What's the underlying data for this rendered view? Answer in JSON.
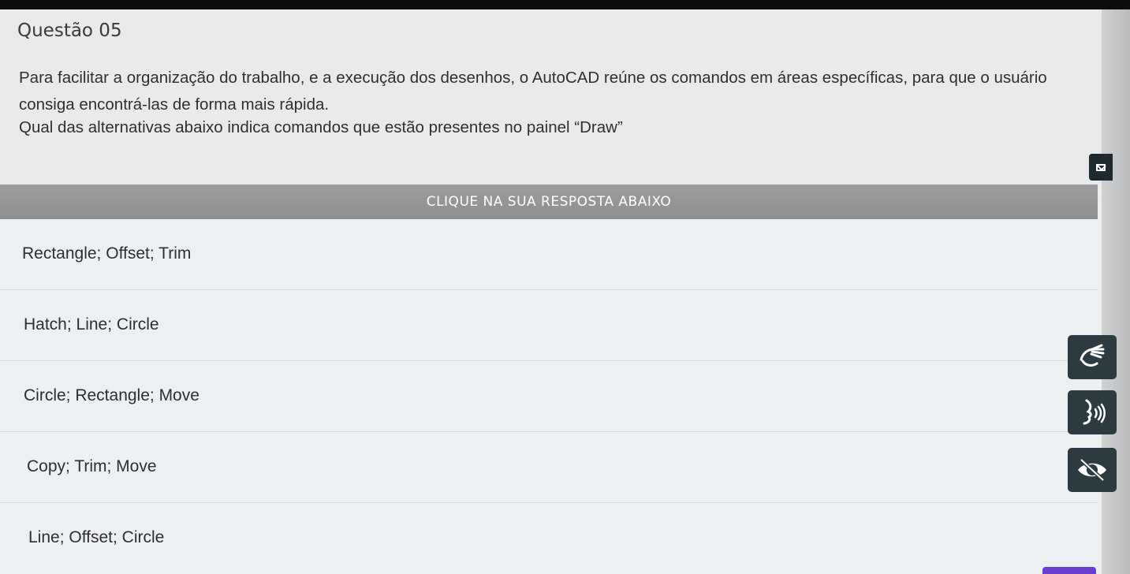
{
  "question": {
    "title": "Questão 05",
    "text": "Para facilitar a organização do trabalho, e a execução dos desenhos, o AutoCAD reúne os comandos em áreas específicas, para que o usuário consiga encontrá-las de forma mais rápida.",
    "prompt": "Qual das alternativas abaixo indica comandos que estão presentes no painel “Draw”"
  },
  "instruction": "CLIQUE NA SUA RESPOSTA ABAIXO",
  "answers": [
    {
      "label": "Rectangle; Offset; Trim"
    },
    {
      "label": "Hatch; Line; Circle"
    },
    {
      "label": "Circle; Rectangle; Move"
    },
    {
      "label": "Copy; Trim; Move"
    },
    {
      "label": "Line; Offset; Circle"
    }
  ],
  "accessibility": {
    "icons": [
      "mail-icon",
      "sign-language-icon",
      "audio-speaker-icon",
      "hide-eye-icon"
    ],
    "button_color": "#2c3b3f"
  },
  "colors": {
    "instruction_bar": "#959798",
    "accent": "#6a3fd0"
  }
}
